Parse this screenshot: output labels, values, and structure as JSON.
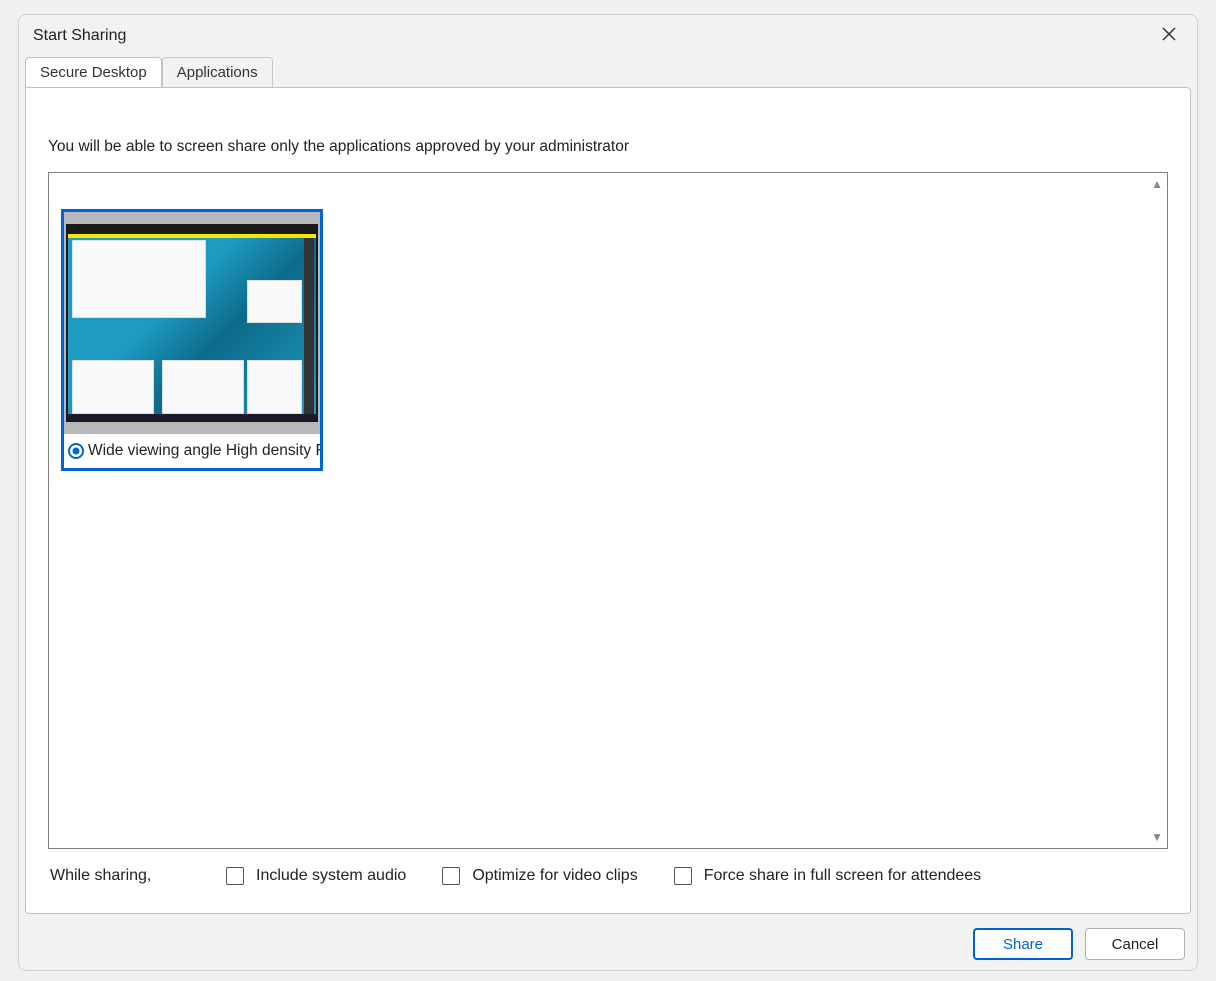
{
  "dialog": {
    "title": "Start Sharing",
    "tabs": [
      {
        "label": "Secure Desktop",
        "active": true
      },
      {
        "label": "Applications",
        "active": false
      }
    ],
    "instruction": "You will be able to screen share only the applications approved by your administrator",
    "monitors": [
      {
        "label": "Wide viewing angle  High density F",
        "selected": true
      }
    ],
    "options": {
      "prefix": "While sharing,",
      "items": [
        {
          "label": "Include system audio",
          "checked": false
        },
        {
          "label": "Optimize for video clips",
          "checked": false
        },
        {
          "label": "Force share in full screen for attendees",
          "checked": false
        }
      ]
    },
    "buttons": {
      "share": "Share",
      "cancel": "Cancel"
    }
  }
}
